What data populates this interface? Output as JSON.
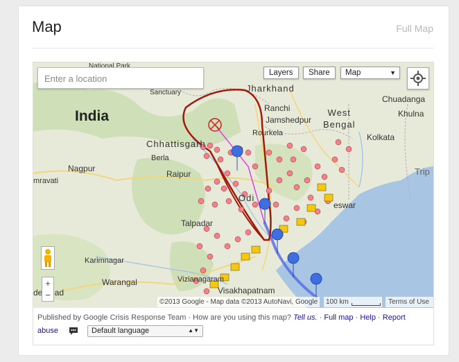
{
  "header": {
    "title": "Map",
    "full_map_label": "Full Map"
  },
  "map": {
    "search_placeholder": "Enter a location",
    "layers_label": "Layers",
    "share_label": "Share",
    "map_type_value": "Map",
    "attribution": "©2013 Google - Map data ©2013 AutoNavi, Google",
    "scale_label": "100 km",
    "terms_label": "Terms of Use",
    "zoom_in": "+",
    "zoom_out": "−",
    "place_labels": {
      "india": "India",
      "jharkhand": "Jharkhand",
      "ranchi": "Ranchi",
      "jamshedpur": "Jamshedpur",
      "rourkela": "Rourkela",
      "west_bengal": "West\nBengal",
      "chuadanga": "Chuadanga",
      "khulna": "Khulna",
      "kolkata": "Kolkata",
      "tripura": "Trip",
      "chhattisgarh": "Chhattisgarh",
      "berla": "Berla",
      "nagpur": "Nagpur",
      "raipur": "Raipur",
      "amravati": "mravati",
      "sanctuary": "Sanctuary",
      "national_park": "National Park",
      "odisha": "Odi",
      "talpadar": "Talpadar",
      "karimnagar": "Karimnagar",
      "warangal": "Warangal",
      "hyderabad": "derabad",
      "vizianagaram": "Vizianagaram",
      "visakhapatnam": "Visakhapatnam",
      "bhubaneswar": "eswar"
    },
    "colors": {
      "land": "#e8ead9",
      "water": "#a8c6e3",
      "cone_outline": "#a01a0a",
      "track": "#5b6ee8",
      "forecast_track": "#e040e0",
      "shelter_dots": "#f2828a",
      "markers": "#3d6fe0"
    }
  },
  "footer": {
    "published_by": "Published by Google Crisis Response Team · How are you using this map?",
    "tell_us": "Tell us.",
    "sep1": "·",
    "full_map": "Full map",
    "sep2": "·",
    "help": "Help",
    "sep3": "·",
    "report": "Report",
    "abuse": "abuse",
    "language_value": "Default language"
  }
}
